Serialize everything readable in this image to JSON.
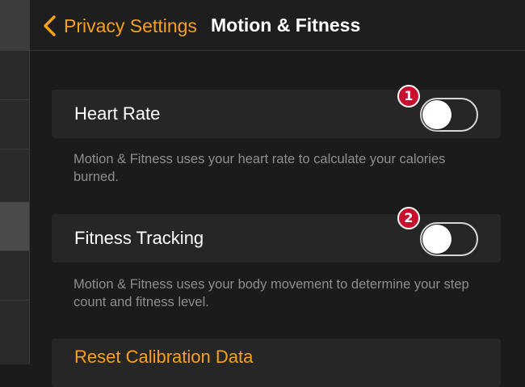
{
  "nav": {
    "back_label": "Privacy Settings",
    "title": "Motion & Fitness"
  },
  "rows": [
    {
      "label": "Heart Rate",
      "enabled": false,
      "annotation": "1",
      "description": "Motion & Fitness uses your heart rate to calculate your calories burned."
    },
    {
      "label": "Fitness Tracking",
      "enabled": false,
      "annotation": "2",
      "description": "Motion & Fitness uses your body movement to determine your step count and fitness level."
    }
  ],
  "reset": {
    "label": "Reset Calibration Data"
  },
  "colors": {
    "accent": "#f7a11a",
    "badge": "#c8102e",
    "background": "#1b1b1b",
    "row_background": "#262626",
    "description_text": "#8e8e8e"
  },
  "icons": {
    "back": "chevron-left-icon"
  }
}
